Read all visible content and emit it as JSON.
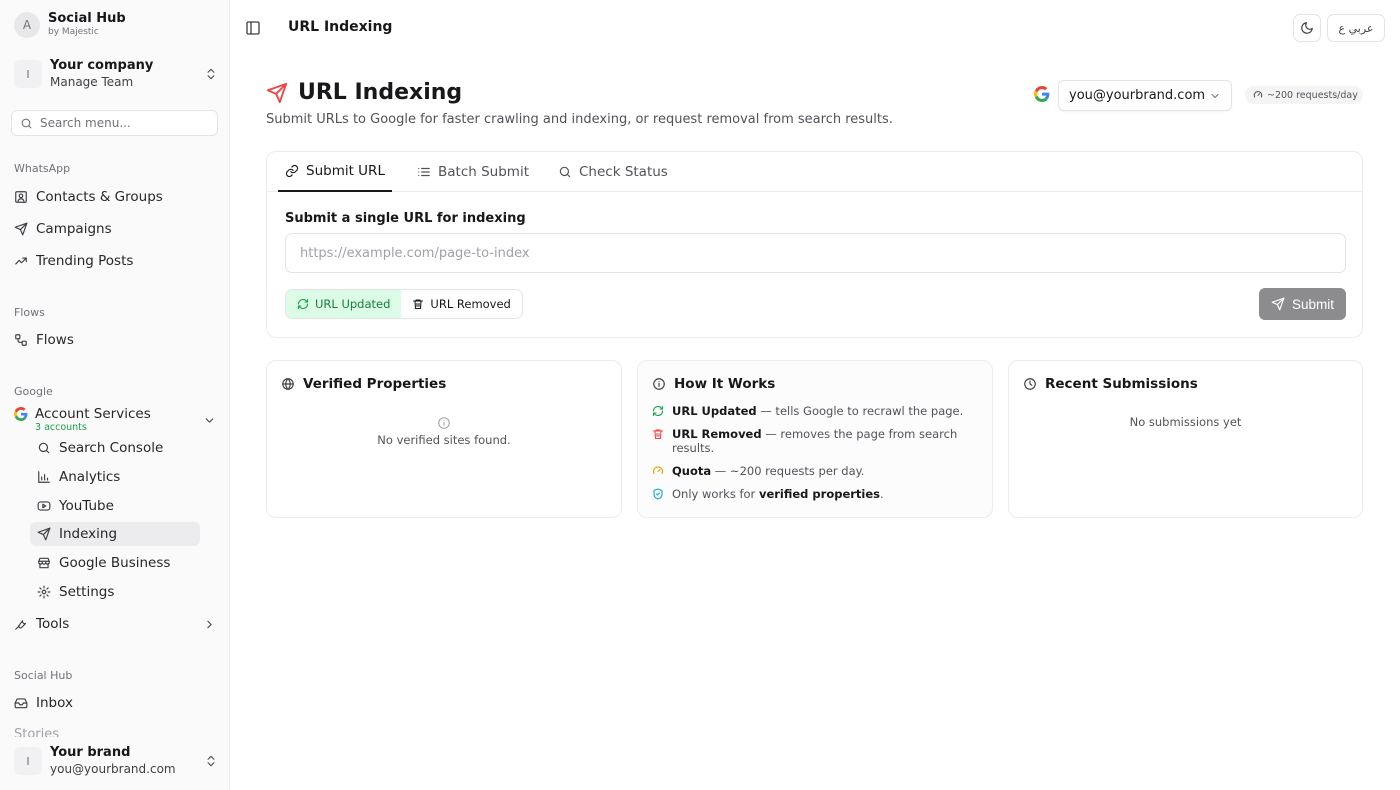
{
  "brand": {
    "initial": "A",
    "name": "Social Hub",
    "sub": "by Majestic"
  },
  "company": {
    "initial": "I",
    "name": "Your company",
    "sub": "Manage Team"
  },
  "search_menu": {
    "placeholder": "Search menu..."
  },
  "sections": {
    "whatsapp": {
      "label": "WhatsApp",
      "items": [
        "Contacts & Groups",
        "Campaigns",
        "Trending Posts"
      ]
    },
    "flows": {
      "label": "Flows",
      "items": [
        "Flows"
      ]
    },
    "google": {
      "label": "Google",
      "account_services": {
        "title": "Account Services",
        "count": "3 accounts"
      },
      "sub_items": [
        "Search Console",
        "Analytics",
        "YouTube",
        "Indexing",
        "Google Business",
        "Settings"
      ],
      "active": "Indexing"
    },
    "tools": {
      "label": "Tools"
    },
    "social_hub": {
      "label": "Social Hub",
      "items": [
        "Inbox",
        "Stories"
      ]
    }
  },
  "user": {
    "initial": "I",
    "name": "Your brand",
    "email": "you@yourbrand.com"
  },
  "topbar": {
    "title": "URL Indexing",
    "lang": "عربي ع"
  },
  "page": {
    "title": "URL Indexing",
    "description": "Submit URLs to Google for faster crawling and indexing, or request removal from search results.",
    "account": "you@yourbrand.com",
    "quota": "~200 requests/day"
  },
  "tabs": [
    "Submit URL",
    "Batch Submit",
    "Check Status"
  ],
  "form": {
    "label": "Submit a single URL for indexing",
    "placeholder": "https://example.com/page-to-index",
    "value": "",
    "type_options": [
      "URL Updated",
      "URL Removed"
    ],
    "selected_type": "URL Updated",
    "submit_label": "Submit"
  },
  "verified": {
    "title": "Verified Properties",
    "empty": "No verified sites found."
  },
  "how_it_works": {
    "title": "How It Works",
    "rows": [
      {
        "bold": "URL Updated",
        "text": " — tells Google to recrawl the page."
      },
      {
        "bold": "URL Removed",
        "text": " — removes the page from search results."
      },
      {
        "bold": "Quota",
        "text": " — ~200 requests per day."
      },
      {
        "pre": "Only works for ",
        "bold": "verified properties",
        "text": "."
      }
    ]
  },
  "recent": {
    "title": "Recent Submissions",
    "empty": "No submissions yet"
  },
  "colors": {
    "accent_red": "#ef4444",
    "success_green": "#16a34a",
    "quota_orange": "#f59e0b",
    "info_blue": "#0ea5e9",
    "disabled_button": "#8c8c8f"
  }
}
